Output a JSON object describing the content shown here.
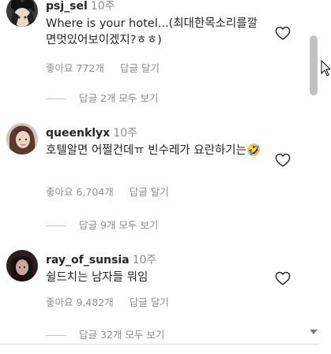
{
  "comments": [
    {
      "username": "psj_sel",
      "time": "10주",
      "text": "Where is your hotel...(최대한목소리를깔면멋있어보이겠지?ㅎㅎ)",
      "likes_label": "좋아요 772개",
      "reply_label": "답글 달기",
      "view_replies": "답글 2개 모두 보기"
    },
    {
      "username": "queenklyx",
      "time": "10주",
      "text": "호텔알면 어쩔건데ㅠ 빈수레가 요란하기는🤣",
      "likes_label": "좋아요 6,704개",
      "reply_label": "답글 달기",
      "view_replies": "답글 9개 모두 보기"
    },
    {
      "username": "ray_of_sunsia",
      "time": "10주",
      "text": "쉴드치는 남자들 뭐임",
      "likes_label": "좋아요 9,482개",
      "reply_label": "답글 달기",
      "view_replies": "답글 32개 모두 보기"
    }
  ],
  "icons": {
    "like": "heart-outline-icon",
    "scroll_down": "scroll-down-arrow-icon",
    "cursor": "mouse-pointer-icon"
  },
  "colors": {
    "text": "#262626",
    "muted": "#8e8e8e",
    "scroll_thumb": "#c1c1c1"
  }
}
